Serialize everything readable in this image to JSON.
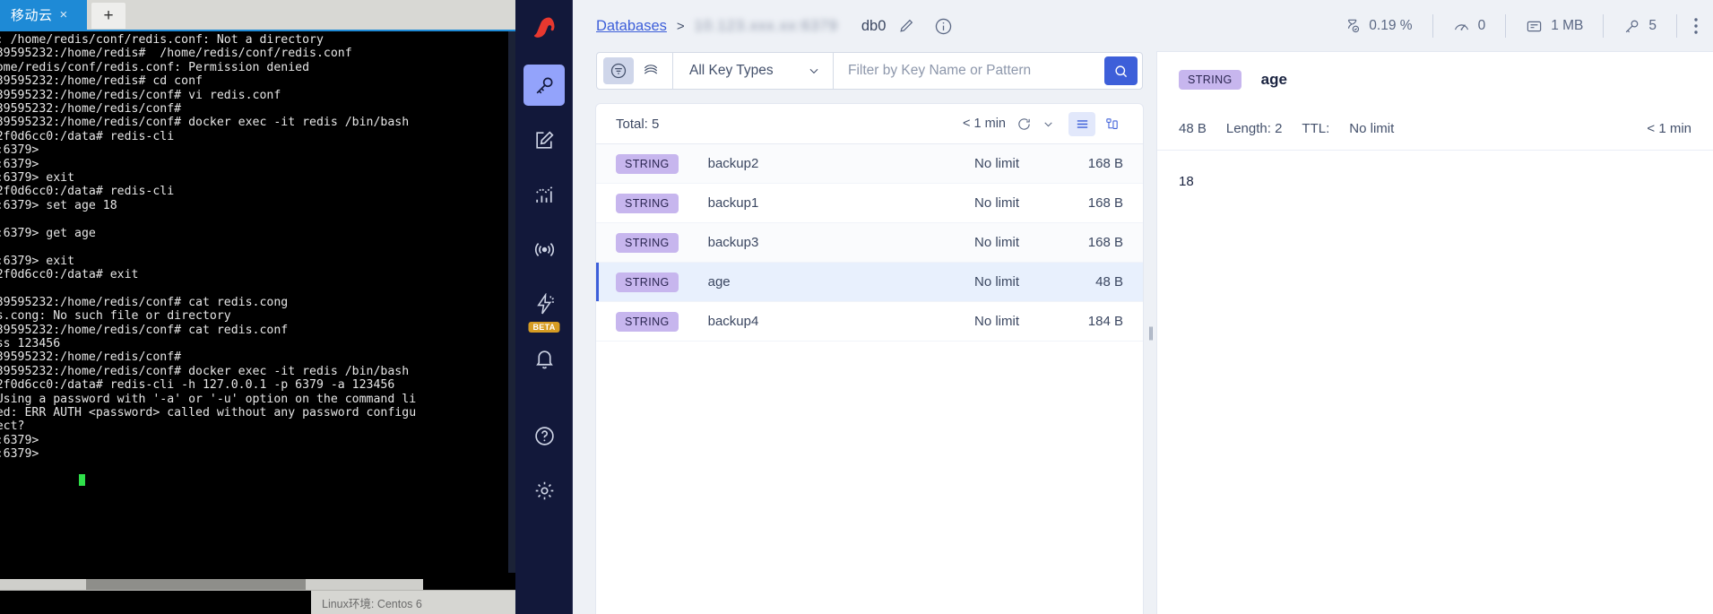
{
  "terminal": {
    "tab_title": "移动云",
    "tab_close": "×",
    "new_tab": "+",
    "lines": "n: cd: /home/redis/conf/redis.conf: Not a directory\n@ecs-39595232:/home/redis#  /home/redis/conf/redis.conf\nn: /home/redis/conf/redis.conf: Permission denied\n@ecs-39595232:/home/redis# cd conf\n@ecs-39595232:/home/redis/conf# vi redis.conf\n@ecs-39595232:/home/redis/conf#\n@ecs-39595232:/home/redis/conf# docker exec -it redis /bin/bash\n@c2b12f0d6cc0:/data# redis-cli\n0.0.1:6379>\n0.0.1:6379>\n0.0.1:6379> exit\n@c2b12f0d6cc0:/data# redis-cli\n0.0.1:6379> set age 18\n\n0.0.1:6379> get age\n\n0.0.1:6379> exit\n@c2b12f0d6cc0:/data# exit\n\n@ecs-39595232:/home/redis/conf# cat redis.cong\n redis.cong: No such file or directory\n@ecs-39595232:/home/redis/conf# cat redis.conf\nirepass 123456\n@ecs-39595232:/home/redis/conf#\n@ecs-39595232:/home/redis/conf# docker exec -it redis /bin/bash\n@c2b12f0d6cc0:/data# redis-cli -h 127.0.0.1 -p 6379 -a 123456\ning: Using a password with '-a' or '-u' option on the command li\n failed: ERR AUTH <password> called without any password configu\n correct?\n0.0.1:6379>\n0.0.1:6379> ",
    "status_text": "Linux环境:  Centos 6"
  },
  "sidebar": {
    "logo": "redis-insight-logo",
    "items": [
      {
        "name": "browser",
        "icon": "key-icon",
        "active": true
      },
      {
        "name": "workbench",
        "icon": "edit-document-icon",
        "active": false
      },
      {
        "name": "analysis",
        "icon": "bar-chart-icon",
        "active": false
      },
      {
        "name": "pubsub",
        "icon": "broadcast-icon",
        "active": false
      },
      {
        "name": "triggers",
        "icon": "lightning-gear-icon",
        "active": false,
        "badge": "BETA"
      },
      {
        "name": "notifications",
        "icon": "bell-icon",
        "active": false
      }
    ],
    "bottom_items": [
      {
        "name": "help",
        "icon": "question-circle-icon"
      },
      {
        "name": "settings",
        "icon": "gear-icon"
      }
    ]
  },
  "header": {
    "breadcrumb_root": "Databases",
    "breadcrumb_separator": ">",
    "breadcrumb_current": "10.123.xxx.xx:6379",
    "db_index": "db0",
    "edit_icon": "pencil-icon",
    "info_icon": "info-circle-icon",
    "stats": [
      {
        "icon": "hourglass-icon",
        "value": "0.19 %"
      },
      {
        "icon": "gauge-icon",
        "value": "0"
      },
      {
        "icon": "memory-card-icon",
        "value": "1 MB"
      },
      {
        "icon": "key-icon",
        "value": "5"
      }
    ],
    "more_icon": "more-vertical-icon"
  },
  "filter_bar": {
    "filter_toggle_icon": "filter-funnel-icon",
    "scan_toggle_icon": "layers-icon",
    "key_type_label": "All Key Types",
    "key_type_chevron": "chevron-down-icon",
    "search_placeholder": "Filter by Key Name or Pattern",
    "search_value": "",
    "search_button_icon": "search-icon"
  },
  "keys_panel": {
    "total_label": "Total: 5",
    "refresh_ago": "< 1 min",
    "refresh_icon": "refresh-icon",
    "refresh_chevron": "chevron-down-icon",
    "view_list_icon": "list-view-icon",
    "view_tree_icon": "tree-view-icon",
    "rows": [
      {
        "type": "STRING",
        "key": "backup2",
        "ttl": "No limit",
        "size": "168 B",
        "selected": false
      },
      {
        "type": "STRING",
        "key": "backup1",
        "ttl": "No limit",
        "size": "168 B",
        "selected": false
      },
      {
        "type": "STRING",
        "key": "backup3",
        "ttl": "No limit",
        "size": "168 B",
        "selected": false
      },
      {
        "type": "STRING",
        "key": "age",
        "ttl": "No limit",
        "size": "48 B",
        "selected": true
      },
      {
        "type": "STRING",
        "key": "backup4",
        "ttl": "No limit",
        "size": "184 B",
        "selected": false
      }
    ]
  },
  "details": {
    "type": "STRING",
    "key_name": "age",
    "size": "48 B",
    "length_label": "Length: 2",
    "ttl_label": "TTL:",
    "ttl_value": "No limit",
    "updated": "< 1 min",
    "value": "18"
  },
  "colors": {
    "accent": "#3d5fd9",
    "sidebar_bg": "#12183a",
    "badge_purple": "#c7b6ee",
    "beta_orange": "#d69c23",
    "terminal_bg": "#000000",
    "tab_blue": "#1e8ad6"
  }
}
